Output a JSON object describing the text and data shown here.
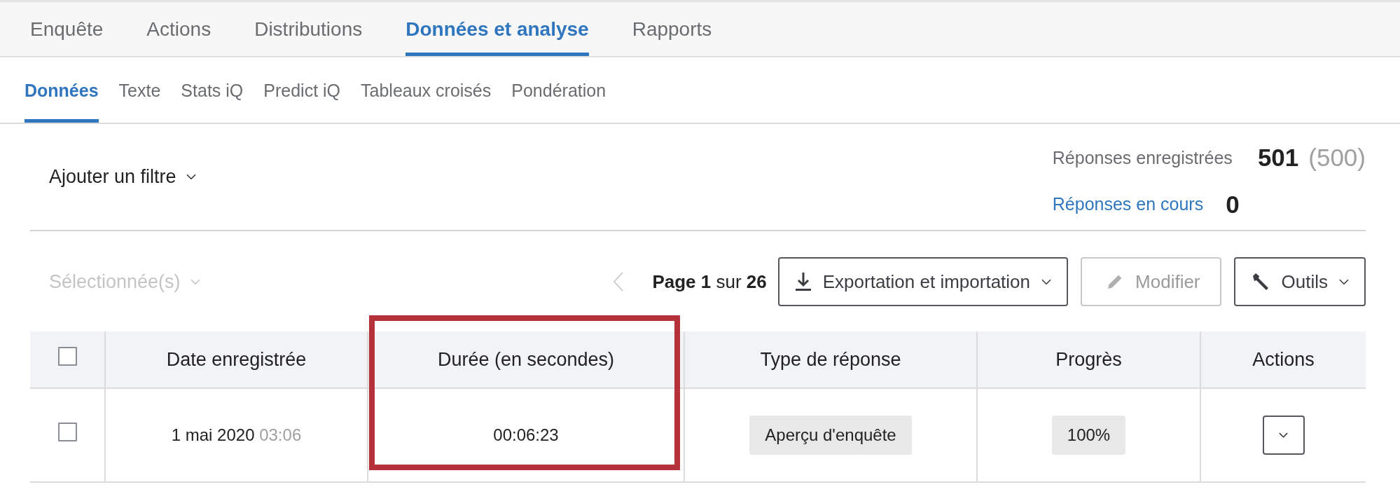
{
  "main_tabs": [
    {
      "label": "Enquête",
      "selected": false
    },
    {
      "label": "Actions",
      "selected": false
    },
    {
      "label": "Distributions",
      "selected": false
    },
    {
      "label": "Données et analyse",
      "selected": true
    },
    {
      "label": "Rapports",
      "selected": false
    }
  ],
  "sub_tabs": [
    {
      "label": "Données",
      "selected": true
    },
    {
      "label": "Texte",
      "selected": false
    },
    {
      "label": "Stats iQ",
      "selected": false
    },
    {
      "label": "Predict iQ",
      "selected": false
    },
    {
      "label": "Tableaux croisés",
      "selected": false
    },
    {
      "label": "Pondération",
      "selected": false
    }
  ],
  "filter": {
    "label": "Ajouter un filtre"
  },
  "stats": {
    "recorded_label": "Réponses enregistrées",
    "recorded_count": "501",
    "recorded_total": "(500)",
    "in_progress_label": "Réponses en cours",
    "in_progress_count": "0"
  },
  "toolbar": {
    "selection": {
      "label": "Sélectionnée(s)",
      "disabled": true
    },
    "pagination": {
      "prev_disabled": true,
      "page_label": "Page",
      "page": "1",
      "of": "sur",
      "total": "26"
    },
    "buttons": [
      {
        "kind": "export",
        "label": "Exportation et importation",
        "disabled": false
      },
      {
        "kind": "edit",
        "label": "Modifier",
        "disabled": true
      },
      {
        "kind": "tools",
        "label": "Outils",
        "disabled": false
      }
    ]
  },
  "table": {
    "select_all_checked": false,
    "columns": [
      {
        "label": "Date enregistrée",
        "highlighted": false
      },
      {
        "label": "Durée (en secondes)",
        "highlighted": true
      },
      {
        "label": "Type de réponse",
        "highlighted": false
      },
      {
        "label": "Progrès",
        "highlighted": false
      },
      {
        "label": "Actions",
        "highlighted": false
      }
    ],
    "rows": [
      {
        "checked": false,
        "date": "1 mai 2020",
        "time": "03:06",
        "duration": "00:06:23",
        "response_type": "Aperçu d'enquête",
        "progress": "100%"
      }
    ]
  }
}
